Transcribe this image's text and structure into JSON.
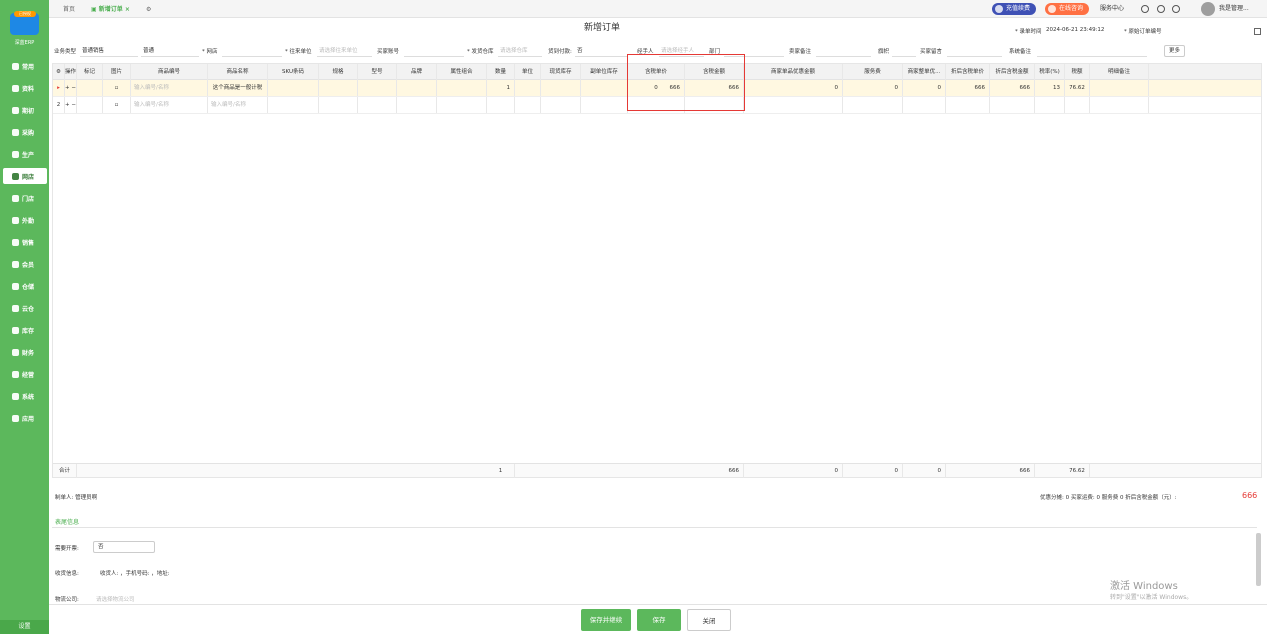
{
  "sidebar": {
    "logo_badge": "已授权",
    "logo_text": "深蓝ERP",
    "items": [
      {
        "label": "常用",
        "icon": "star-icon"
      },
      {
        "label": "资料",
        "icon": "database-icon"
      },
      {
        "label": "期初",
        "icon": "gear-icon"
      },
      {
        "label": "采购",
        "icon": "cart-icon"
      },
      {
        "label": "生产",
        "icon": "factory-icon"
      },
      {
        "label": "网店",
        "icon": "shop-icon"
      },
      {
        "label": "门店",
        "icon": "store-icon"
      },
      {
        "label": "外勤",
        "icon": "field-icon"
      },
      {
        "label": "销售",
        "icon": "sales-icon"
      },
      {
        "label": "会员",
        "icon": "member-icon"
      },
      {
        "label": "仓储",
        "icon": "warehouse-icon"
      },
      {
        "label": "云仓",
        "icon": "cloud-icon"
      },
      {
        "label": "库存",
        "icon": "stock-icon"
      },
      {
        "label": "财务",
        "icon": "finance-icon"
      },
      {
        "label": "经营",
        "icon": "business-icon"
      },
      {
        "label": "系统",
        "icon": "system-icon"
      },
      {
        "label": "应用",
        "icon": "apps-icon"
      }
    ],
    "active_index": 5,
    "settings_label": "设置"
  },
  "topbar": {
    "tabs": [
      "首页",
      "新增订单 ×"
    ],
    "recharge_label": "充值续费",
    "consult_label": "在线咨询",
    "service_label": "服务中心",
    "user_label": "我是管理..."
  },
  "page": {
    "title": "新增订单",
    "order_time_label": "* 录单时间",
    "order_time": "2024-06-21 23:49:12",
    "original_no_label": "* 原始订单编号"
  },
  "form": {
    "biz_type_label": "业务类型",
    "biz_type": "普通销售",
    "normal": "普通",
    "shop_label": "* 网店",
    "partner_label": "* 往来单位",
    "partner_ph": "请选择往来单位",
    "buyer_label": "买家账号",
    "ship_wh_label": "* 发货仓库",
    "ship_wh_ph": "请选择仓库",
    "cod_label": "货到付款:",
    "cod_value": "否",
    "handler_label": "经手人",
    "handler_ph": "请选择经手人",
    "dept_label": "部门",
    "seller_remark_label": "卖家备注",
    "flag_label": "旗帜",
    "buyer_msg_label": "买家留言",
    "sys_remark_label": "系统备注",
    "more_label": "更多"
  },
  "grid": {
    "headers": [
      "操作",
      "标记",
      "图片",
      "商品编号",
      "商品名称",
      "SKU条码",
      "规格",
      "型号",
      "品牌",
      "属性组合",
      "数量",
      "单位",
      "现货库存",
      "副单位库存",
      "含税单价",
      "含税金额",
      "商家单品优惠金额",
      "服务费",
      "商家整单优...",
      "折后含税单价",
      "折后含税金额",
      "税率(%)",
      "税额",
      "明细备注"
    ],
    "rows": [
      {
        "index": "",
        "code_ph": "输入编号/名称",
        "name": "这个商品是一般计税",
        "qty": "1",
        "discount_pct": "0",
        "price": "666",
        "amount": "666",
        "item_discount": "0",
        "service_fee": "0",
        "order_discount": "0",
        "after_price": "666",
        "after_amount": "666",
        "tax_rate": "13",
        "tax": "76.62"
      },
      {
        "index": "2",
        "code_ph": "输入编号/名称",
        "name_ph": "输入编号/名称"
      }
    ],
    "sum": {
      "label": "合计",
      "qty": "1",
      "amount": "666",
      "item_discount": "0",
      "service_fee": "0",
      "order_discount": "0",
      "after_amount": "666",
      "tax": "76.62"
    }
  },
  "footer": {
    "maker_label": "制单人: 管理员啊",
    "summary": "优惠分摊: 0  买家运费: 0  服务费 0  折后含税金额（元）:",
    "total": "666",
    "section_tab": "表尾信息",
    "invoice_label": "需要开票:",
    "invoice_value": "否",
    "receiver_label": "收货信息:",
    "receiver_value": "收货人: ，手机号码: ，地址:",
    "logistics_label": "物流公司:",
    "logistics_ph": "请选择物流公司"
  },
  "buttons": {
    "save_continue": "保存并继续",
    "save": "保存",
    "close": "关闭"
  },
  "watermark": {
    "line1": "激活 Windows",
    "line2": "转到\"设置\"以激活 Windows。"
  },
  "colors": {
    "brand_green": "#5cb85c",
    "highlight_red": "#e53935",
    "recharge_blue": "#3f51b5",
    "consult_orange": "#ff7043"
  }
}
